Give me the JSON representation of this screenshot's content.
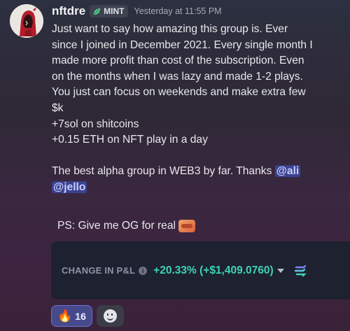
{
  "message": {
    "username": "nftdre",
    "badge": {
      "label": "MINT",
      "icon": "leaf-icon"
    },
    "timestamp": "Yesterday at 11:55 PM",
    "lines": [
      "Just want to say how amazing this group is. Ever",
      "since I joined in December 2021. Every single month I",
      "made more profit than cost of the subscription. Even",
      "on the months when I was lazy and made 1-2 plays.",
      "You just can focus on weekends and make extra few",
      "$k",
      "+7sol on shitcoins",
      "+0.15 ETH on NFT play in a day"
    ],
    "closing_text": "The best alpha group in WEB3 by far. Thanks ",
    "mentions": [
      "@ali",
      "@jello"
    ],
    "ps_text": "PS: Give me OG for real"
  },
  "embed": {
    "label": "CHANGE IN P&L",
    "value": "+20.33% (+$1,409.0760)",
    "accent_color": "#3ed3b3"
  },
  "reactions": [
    {
      "emoji": "🔥",
      "count": "16",
      "active": true
    }
  ],
  "colors": {
    "mention_bg": "#3b4290",
    "card_bg": "#1e2130"
  }
}
